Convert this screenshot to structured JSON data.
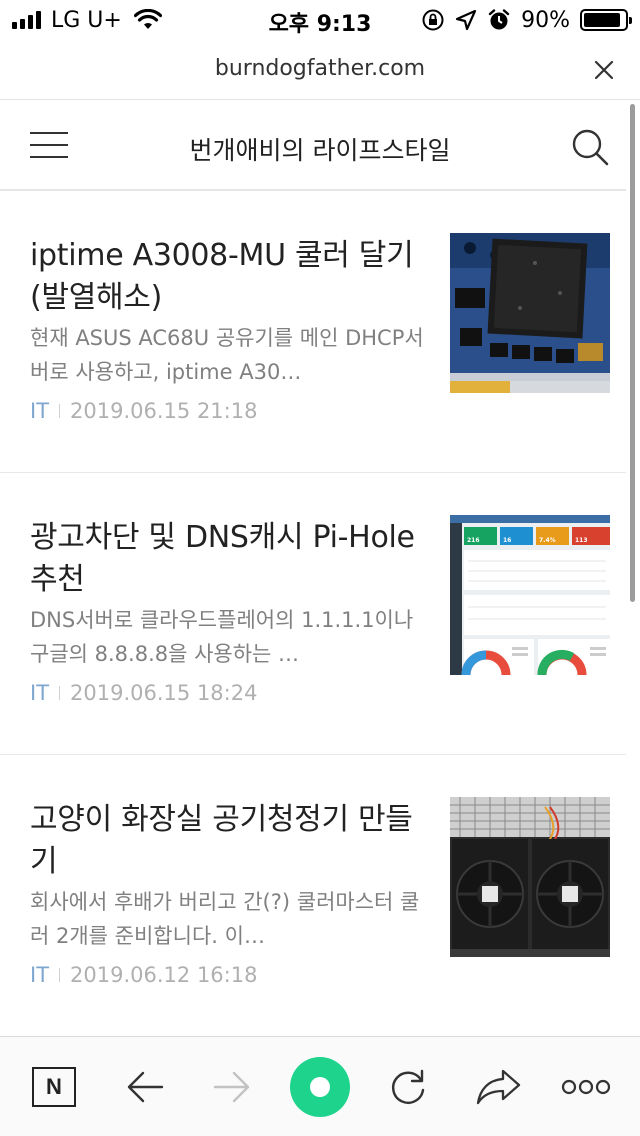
{
  "status_bar": {
    "carrier": "LG U+",
    "time": "오후 9:13",
    "battery": "90%",
    "battery_level": 0.9,
    "icons": [
      "signal-icon",
      "wifi-icon",
      "rotation-lock-icon",
      "location-icon",
      "alarm-icon",
      "battery-icon"
    ]
  },
  "browser": {
    "url": "burndogfather.com",
    "close_icon": "close-icon"
  },
  "blog": {
    "title": "번개애비의 라이프스타일",
    "menu_icon": "hamburger-menu-icon",
    "search_icon": "search-icon"
  },
  "articles": [
    {
      "title": "iptime A3008-MU 쿨러 달기 (발열해소)",
      "snippet": "현재 ASUS AC68U 공유기를 메인 DHCP서버로 사용하고, iptime A30…",
      "category": "IT",
      "date": "2019.06.15 21:18",
      "thumbnail": "router-board-heatsink-photo"
    },
    {
      "title": "광고차단 및 DNS캐시 Pi-Hole 추천",
      "snippet": "DNS서버로 클라우드플레어의 1.1.1.1이나 구글의 8.8.8.8을 사용하는 …",
      "category": "IT",
      "date": "2019.06.15 18:24",
      "thumbnail": "pi-hole-dashboard-screenshot",
      "thumb_stats": [
        "216",
        "16",
        "7.4%",
        "113"
      ]
    },
    {
      "title": "고양이 화장실 공기청정기 만들기",
      "snippet": "회사에서 후배가 버리고 간(?) 쿨러마스터 쿨러 2개를 준비합니다. 이…",
      "category": "IT",
      "date": "2019.06.12 16:18",
      "thumbnail": "two-cooling-fans-photo"
    }
  ],
  "toolbar": {
    "items": [
      "naver-icon",
      "back-arrow-icon",
      "forward-arrow-icon",
      "green-home-icon",
      "refresh-icon",
      "share-icon",
      "more-icon"
    ],
    "naver_label": "N",
    "accent": "#1ed38c"
  },
  "colors": {
    "category": "#7ea7d0",
    "meta": "#b0b0b0",
    "snippet": "#808080"
  }
}
